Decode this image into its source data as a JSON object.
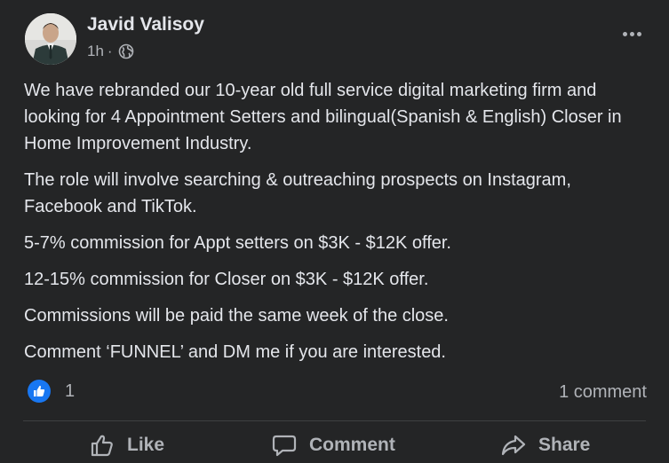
{
  "post": {
    "author": "Javid Valisoy",
    "time": "1h",
    "separator": "·",
    "privacy_icon": "globe-icon",
    "menu_icon": "more-horizontal-icon",
    "paragraphs": [
      "We have rebranded our 10-year old full service digital marketing firm and looking for 4 Appointment Setters and bilingual(Spanish & English) Closer in Home Improvement Industry.",
      "The role will involve searching & outreaching prospects on Instagram, Facebook and TikTok.",
      "5-7% commission for Appt setters on $3K - $12K offer.",
      "12-15% commission for Closer on $3K - $12K offer.",
      "Commissions will be paid the same week of the close.",
      "Comment ‘FUNNEL’ and DM me if you are interested."
    ],
    "reaction_count": "1",
    "comment_count": "1 comment"
  },
  "actions": {
    "like": "Like",
    "comment": "Comment",
    "share": "Share"
  },
  "colors": {
    "background": "#242526",
    "text": "#e4e6eb",
    "secondary_text": "#b0b3b8",
    "like_blue": "#1877f2",
    "divider": "#3e4042"
  }
}
